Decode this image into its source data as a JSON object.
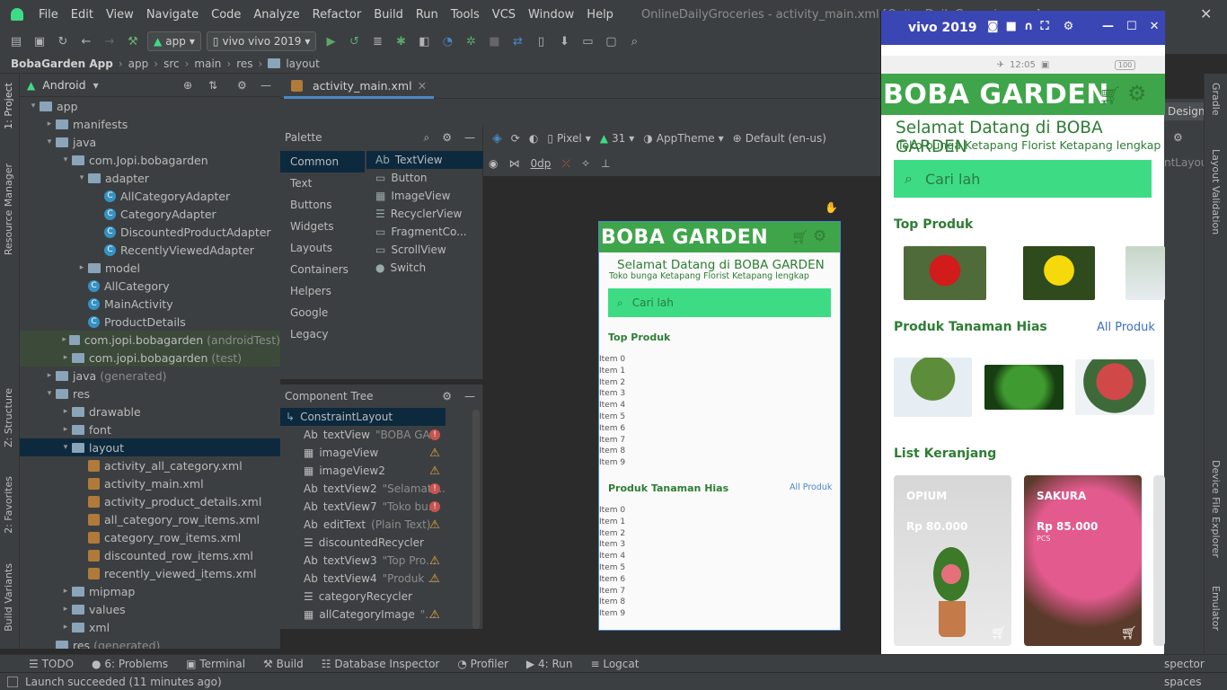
{
  "menu": {
    "items": [
      "File",
      "Edit",
      "View",
      "Navigate",
      "Code",
      "Analyze",
      "Refactor",
      "Build",
      "Run",
      "Tools",
      "VCS",
      "Window",
      "Help"
    ],
    "window_title": "OnlineDailyGroceries - activity_main.xml [OnlineDailyGroceries.app]"
  },
  "toolbar": {
    "run_config": "app",
    "device": "vivo vivo 2019"
  },
  "breadcrumb": [
    "BobaGarden App",
    "app",
    "src",
    "main",
    "res",
    "layout"
  ],
  "left_strip": {
    "project": "1: Project",
    "resource_manager": "Resource Manager",
    "structure": "Z: Structure",
    "favorites": "2: Favorites",
    "build_variants": "Build Variants"
  },
  "project": {
    "view": "Android",
    "tree": [
      {
        "label": "app",
        "indent": 0,
        "arrow": "▾",
        "icon": "folder"
      },
      {
        "label": "manifests",
        "indent": 1,
        "arrow": "▸",
        "icon": "folder"
      },
      {
        "label": "java",
        "indent": 1,
        "arrow": "▾",
        "icon": "folder"
      },
      {
        "label": "com.Jopi.bobagarden",
        "indent": 2,
        "arrow": "▾",
        "icon": "folder"
      },
      {
        "label": "adapter",
        "indent": 3,
        "arrow": "▾",
        "icon": "folder"
      },
      {
        "label": "AllCategoryAdapter",
        "indent": 4,
        "arrow": "",
        "icon": "class"
      },
      {
        "label": "CategoryAdapter",
        "indent": 4,
        "arrow": "",
        "icon": "class"
      },
      {
        "label": "DiscountedProductAdapter",
        "indent": 4,
        "arrow": "",
        "icon": "class"
      },
      {
        "label": "RecentlyViewedAdapter",
        "indent": 4,
        "arrow": "",
        "icon": "class"
      },
      {
        "label": "model",
        "indent": 3,
        "arrow": "▸",
        "icon": "folder"
      },
      {
        "label": "AllCategory",
        "indent": 3,
        "arrow": "",
        "icon": "class"
      },
      {
        "label": "MainActivity",
        "indent": 3,
        "arrow": "",
        "icon": "class"
      },
      {
        "label": "ProductDetails",
        "indent": 3,
        "arrow": "",
        "icon": "class"
      },
      {
        "label": "com.jopi.bobagarden",
        "suffix": "(androidTest)",
        "indent": 2,
        "arrow": "▸",
        "icon": "folder",
        "hl": true
      },
      {
        "label": "com.jopi.bobagarden",
        "suffix": "(test)",
        "indent": 2,
        "arrow": "▸",
        "icon": "folder",
        "hl": true
      },
      {
        "label": "java",
        "suffix": "(generated)",
        "indent": 1,
        "arrow": "▸",
        "icon": "folder"
      },
      {
        "label": "res",
        "indent": 1,
        "arrow": "▾",
        "icon": "folder"
      },
      {
        "label": "drawable",
        "indent": 2,
        "arrow": "▸",
        "icon": "folder"
      },
      {
        "label": "font",
        "indent": 2,
        "arrow": "▸",
        "icon": "folder"
      },
      {
        "label": "layout",
        "indent": 2,
        "arrow": "▾",
        "icon": "folder",
        "sel": true
      },
      {
        "label": "activity_all_category.xml",
        "indent": 3,
        "arrow": "",
        "icon": "xml"
      },
      {
        "label": "activity_main.xml",
        "indent": 3,
        "arrow": "",
        "icon": "xml"
      },
      {
        "label": "activity_product_details.xml",
        "indent": 3,
        "arrow": "",
        "icon": "xml"
      },
      {
        "label": "all_category_row_items.xml",
        "indent": 3,
        "arrow": "",
        "icon": "xml"
      },
      {
        "label": "category_row_items.xml",
        "indent": 3,
        "arrow": "",
        "icon": "xml"
      },
      {
        "label": "discounted_row_items.xml",
        "indent": 3,
        "arrow": "",
        "icon": "xml"
      },
      {
        "label": "recently_viewed_items.xml",
        "indent": 3,
        "arrow": "",
        "icon": "xml"
      },
      {
        "label": "mipmap",
        "indent": 2,
        "arrow": "▸",
        "icon": "folder"
      },
      {
        "label": "values",
        "indent": 2,
        "arrow": "▸",
        "icon": "folder"
      },
      {
        "label": "xml",
        "indent": 2,
        "arrow": "▸",
        "icon": "folder"
      },
      {
        "label": "res",
        "suffix": "(generated)",
        "indent": 1,
        "arrow": "",
        "icon": "folder"
      }
    ]
  },
  "editor": {
    "tab": "activity_main.xml"
  },
  "palette": {
    "title": "Palette",
    "categories": [
      "Common",
      "Text",
      "Buttons",
      "Widgets",
      "Layouts",
      "Containers",
      "Helpers",
      "Google",
      "Legacy"
    ],
    "items": [
      {
        "icon": "Ab",
        "label": "TextView"
      },
      {
        "icon": "▭",
        "label": "Button"
      },
      {
        "icon": "▦",
        "label": "ImageView"
      },
      {
        "icon": "☰",
        "label": "RecyclerView"
      },
      {
        "icon": "▭",
        "label": "FragmentCo..."
      },
      {
        "icon": "▭",
        "label": "ScrollView"
      },
      {
        "icon": "●",
        "label": "Switch"
      }
    ]
  },
  "component_tree": {
    "title": "Component Tree",
    "root": "ConstraintLayout",
    "rows": [
      {
        "icon": "Ab",
        "label": "textView",
        "hint": "\"BOBA GA...",
        "status": "err"
      },
      {
        "icon": "▦",
        "label": "imageView",
        "hint": "",
        "status": "warn"
      },
      {
        "icon": "▦",
        "label": "imageView2",
        "hint": "",
        "status": "warn"
      },
      {
        "icon": "Ab",
        "label": "textView2",
        "hint": "\"Selamat ...",
        "status": "err"
      },
      {
        "icon": "Ab",
        "label": "textView7",
        "hint": "\"Toko bu...",
        "status": "err"
      },
      {
        "icon": "Ab",
        "label": "editText",
        "hint": "(Plain Text)",
        "status": "warn"
      },
      {
        "icon": "☰",
        "label": "discountedRecycler",
        "hint": "",
        "status": ""
      },
      {
        "icon": "Ab",
        "label": "textView3",
        "hint": "\"Top Pro...",
        "status": "warn"
      },
      {
        "icon": "Ab",
        "label": "textView4",
        "hint": "\"Produk ...",
        "status": "warn"
      },
      {
        "icon": "☰",
        "label": "categoryRecycler",
        "hint": "",
        "status": ""
      },
      {
        "icon": "▦",
        "label": "allCategoryImage",
        "hint": "\"...",
        "status": "warn"
      }
    ]
  },
  "design_toolbar": {
    "device": "Pixel",
    "api": "31",
    "theme": "AppTheme",
    "locale": "Default (en-us)",
    "margin": "0dp"
  },
  "preview": {
    "title": "BOBA GARDEN",
    "welcome": "Selamat Datang di BOBA GARDEN",
    "subtitle": "Toko bunga Ketapang Florist Ketapang lengkap",
    "search": "Cari lah",
    "top": "Top Produk",
    "hias": "Produk Tanaman Hias",
    "all": "All Produk",
    "items": [
      "Item 0",
      "Item 1",
      "Item 2",
      "Item 3",
      "Item 4",
      "Item 5",
      "Item 6",
      "Item 7",
      "Item 8",
      "Item 9"
    ]
  },
  "emulator": {
    "title": "vivo 2019",
    "time": "12:05",
    "battery": "100",
    "app_title": "BOBA GARDEN",
    "welcome": "Selamat Datang di BOBA GARDEN",
    "subtitle": "Toko bunga Ketapang Florist Ketapang lengkap",
    "search": "Cari lah",
    "top": "Top Produk",
    "hias": "Produk Tanaman Hias",
    "all": "All Produk",
    "cart_title": "List Keranjang",
    "cart": [
      {
        "name": "OPIUM",
        "price": "Rp 80.000"
      },
      {
        "name": "SAKURA",
        "price": "Rp 85.000",
        "qty": "PCS"
      }
    ]
  },
  "right_fragments": {
    "design": "Design",
    "layout": "ntLayout"
  },
  "right_strip": {
    "gradle": "Gradle",
    "layout_validation": "Layout Validation",
    "device_file_explorer": "Device File Explorer",
    "emulator": "Emulator"
  },
  "bottom": {
    "items": [
      "TODO",
      "6: Problems",
      "Terminal",
      "Build",
      "Database Inspector",
      "Profiler",
      "4: Run",
      "Logcat"
    ],
    "right": "spector"
  },
  "status": {
    "text": "Launch succeeded (11 minutes ago)",
    "right": "spaces"
  },
  "colors": {
    "green": "#3fa54a",
    "indigo": "#3b46b5",
    "accent": "#4a88c7"
  }
}
